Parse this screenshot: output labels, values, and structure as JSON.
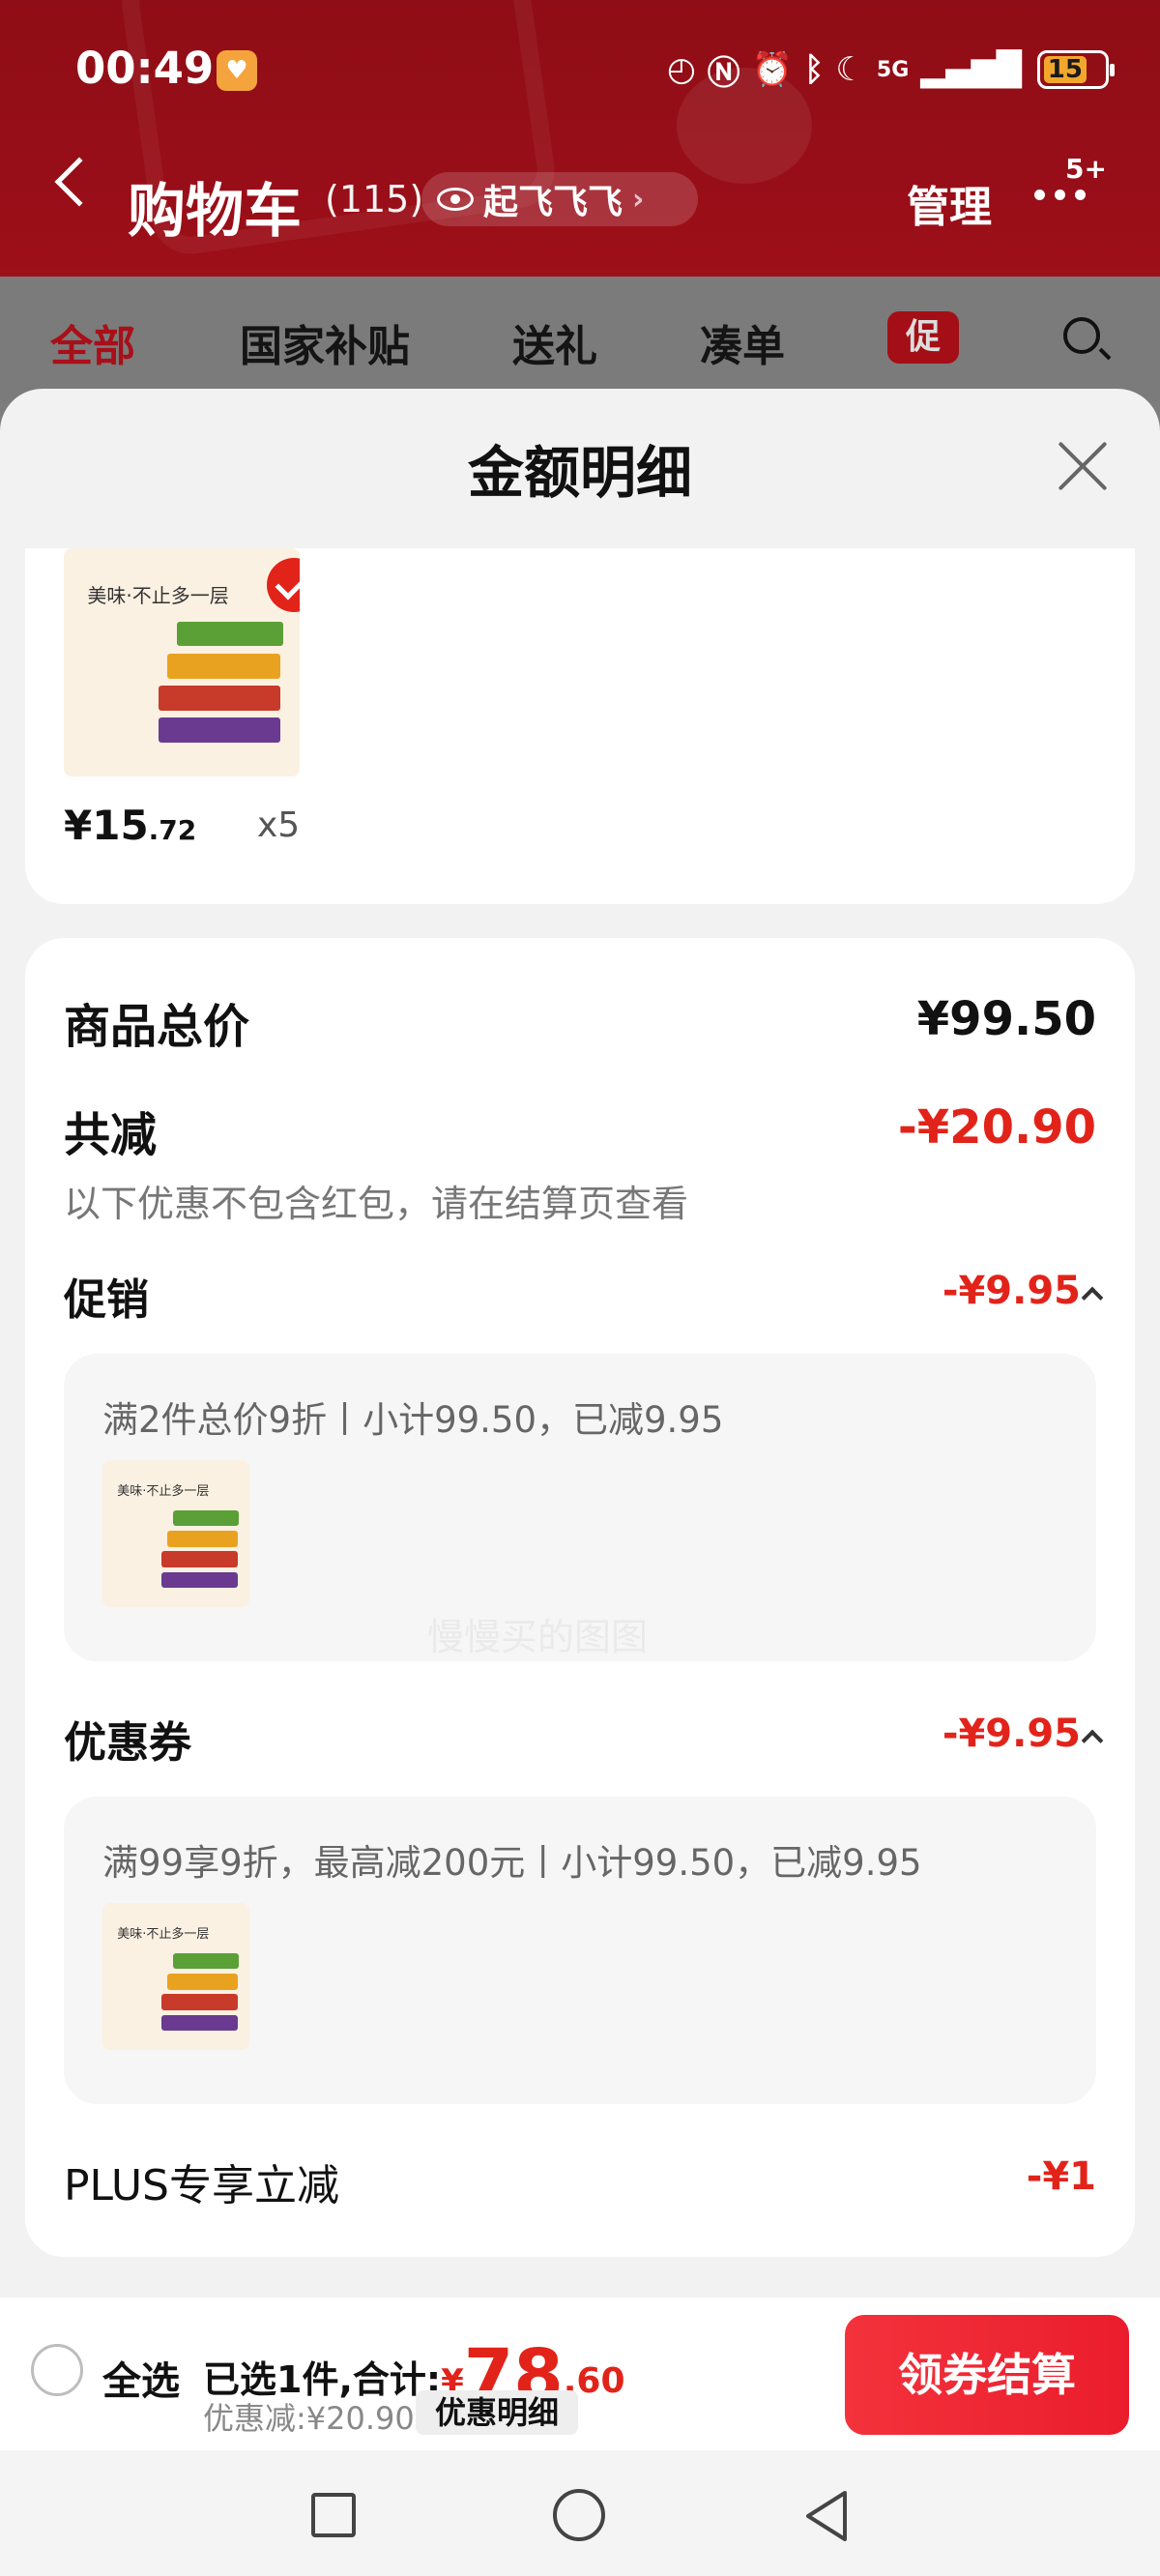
{
  "status_bar": {
    "time": "00:49",
    "network": "5G",
    "battery": "15"
  },
  "header": {
    "title": "购物车",
    "count": "(115)",
    "pill_text": "起飞飞飞",
    "manage": "管理",
    "more_badge": "5+"
  },
  "tabs": [
    {
      "label": "全部",
      "active": true
    },
    {
      "label": "国家补贴"
    },
    {
      "label": "送礼"
    },
    {
      "label": "凑单"
    },
    {
      "label": "促"
    }
  ],
  "sheet": {
    "title": "金额明细",
    "product": {
      "price_int": "¥15",
      "price_dec": ".72",
      "qty": "x5",
      "image_title": "美味·不止多一层"
    },
    "summary": {
      "total_label": "商品总价",
      "total_value": "¥99.50",
      "reduce_label": "共减",
      "reduce_value": "-¥20.90",
      "note": "以下优惠不包含红包，请在结算页查看"
    },
    "promo": {
      "label": "促销",
      "value": "-¥9.95",
      "detail": "满2件总价9折丨小计99.50，已减9.95"
    },
    "coupon": {
      "label": "优惠券",
      "value": "-¥9.95",
      "detail": "满99享9折，最高减200元丨小计99.50，已减9.95"
    },
    "plus": {
      "label": "PLUS专享立减",
      "value": "-¥1"
    },
    "watermark": "慢慢买的图图"
  },
  "bottom_bar": {
    "select_all": "全选",
    "selected_text": "已选1件,合计:",
    "currency": "¥",
    "total_int": "78",
    "total_dec": ".60",
    "discount_text": "优惠减:¥20.90",
    "detail_button": "优惠明细",
    "checkout_button": "领券结算"
  },
  "colors": {
    "brand_red": "#e2231a",
    "header_red": "#9d0f19"
  }
}
